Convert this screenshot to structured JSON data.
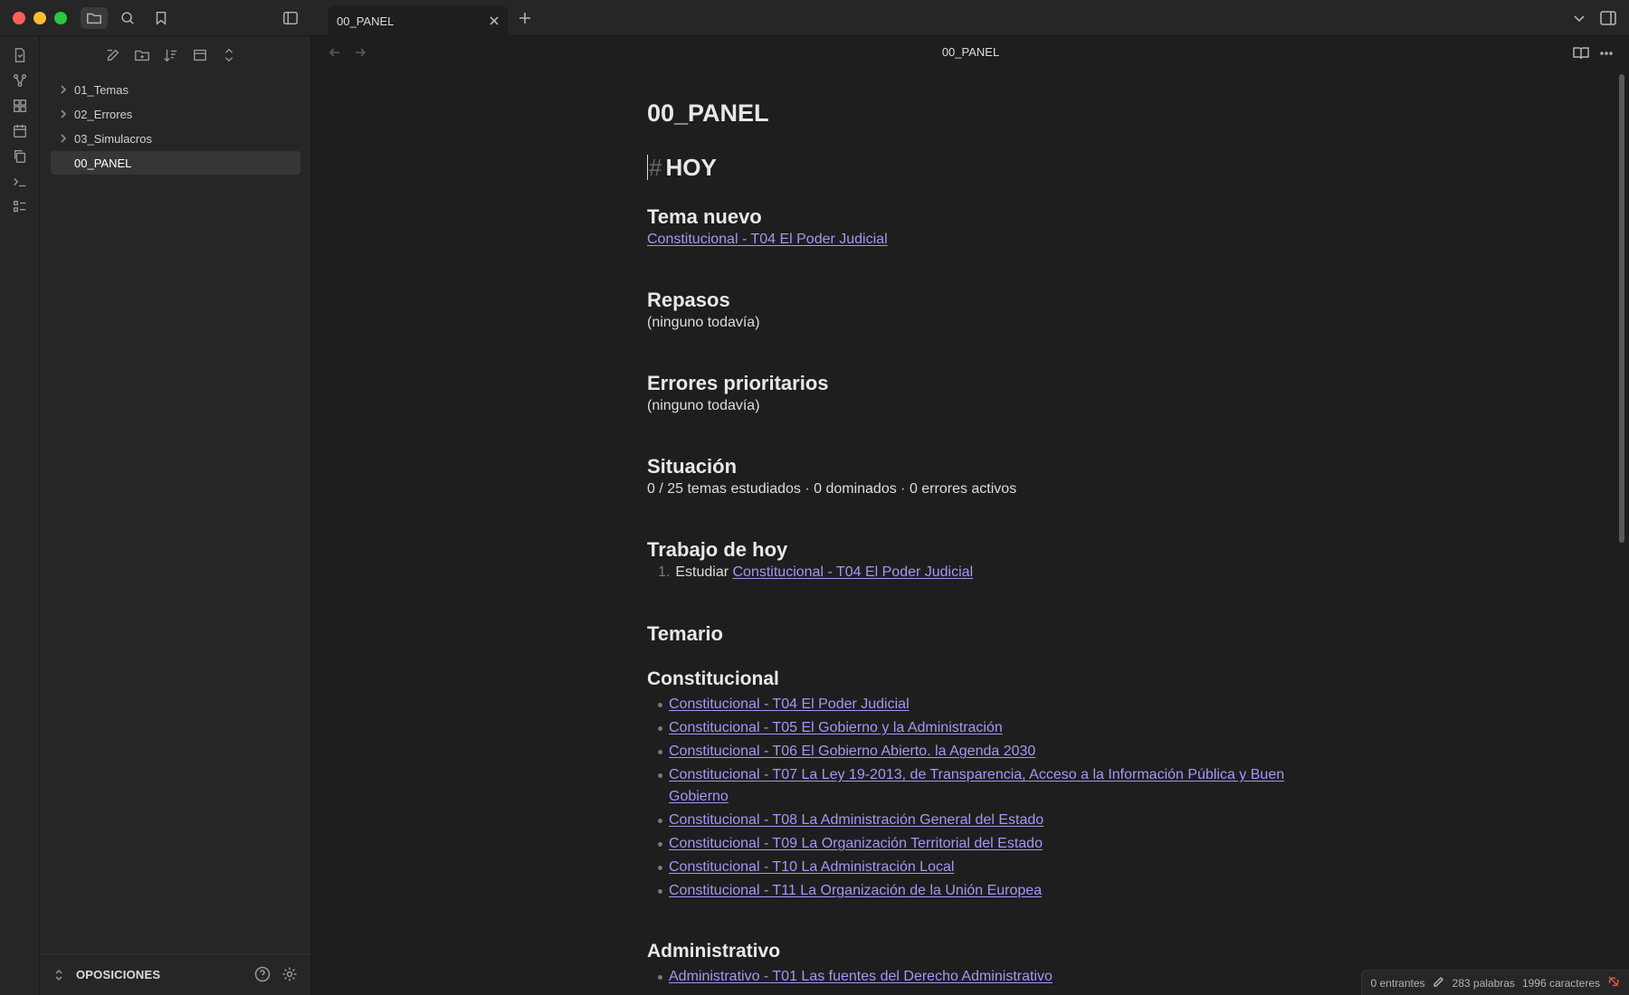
{
  "tab": {
    "label": "00_PANEL"
  },
  "sidebar": {
    "items": [
      {
        "label": "01_Temas",
        "folder": true
      },
      {
        "label": "02_Errores",
        "folder": true
      },
      {
        "label": "03_Simulacros",
        "folder": true
      },
      {
        "label": "00_PANEL",
        "folder": false,
        "active": true
      }
    ],
    "vault_name": "OPOSICIONES"
  },
  "view": {
    "title": "00_PANEL"
  },
  "doc": {
    "title": "00_PANEL",
    "h1_hash": "#",
    "h1": "HOY",
    "tema_nuevo": {
      "heading": "Tema nuevo",
      "link": "Constitucional - T04 El Poder Judicial"
    },
    "repasos": {
      "heading": "Repasos",
      "text": "(ninguno todavía)"
    },
    "errores": {
      "heading": "Errores prioritarios",
      "text": "(ninguno todavía)"
    },
    "situacion": {
      "heading": "Situación",
      "text": "0 / 25 temas estudiados · 0 dominados · 0 errores activos"
    },
    "trabajo": {
      "heading": "Trabajo de hoy",
      "num": "1.",
      "prefix": "Estudiar",
      "link": "Constitucional - T04 El Poder Judicial"
    },
    "temario": {
      "heading": "Temario"
    },
    "constitucional": {
      "heading": "Constitucional",
      "items": [
        "Constitucional - T04 El Poder Judicial",
        "Constitucional - T05 El Gobierno y la Administración",
        "Constitucional - T06 El Gobierno Abierto. la Agenda 2030",
        "Constitucional - T07 La Ley 19-2013, de Transparencia, Acceso a la Información Pública y Buen Gobierno",
        "Constitucional - T08 La Administración General del Estado",
        "Constitucional - T09 La Organización Territorial del Estado",
        "Constitucional - T10 La Administración Local",
        "Constitucional - T11 La Organización de la Unión Europea"
      ]
    },
    "administrativo": {
      "heading": "Administrativo",
      "items": [
        "Administrativo - T01 Las fuentes del Derecho Administrativo"
      ]
    }
  },
  "status": {
    "backlinks": "0 entrantes",
    "words": "283 palabras",
    "chars": "1996 caracteres"
  }
}
